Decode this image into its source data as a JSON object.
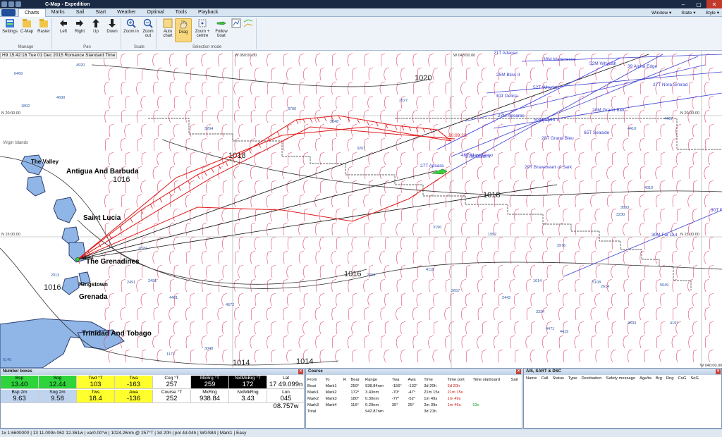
{
  "window": {
    "title": "C-Map - Expedition",
    "controls": [
      "–",
      "▢",
      "✕"
    ]
  },
  "menu": {
    "tabs": [
      "Charts",
      "Marks",
      "Sail",
      "Start",
      "Weather",
      "Optimal",
      "Tools",
      "Playback"
    ],
    "active_tab": "Charts",
    "right": [
      "Window ▾",
      "State ▾",
      "Style ▾"
    ]
  },
  "ribbon": {
    "groups": [
      {
        "label": "Manage",
        "buttons": [
          "Settings",
          "C-Map",
          "Raster"
        ]
      },
      {
        "label": "Pan",
        "buttons": [
          "Left",
          "Right",
          "Up",
          "Down"
        ]
      },
      {
        "label": "Scale",
        "buttons": [
          "Zoom in",
          "Zoom out"
        ]
      },
      {
        "label": "Selection mode",
        "buttons": [
          "Auto chart",
          "Drag",
          "Zoom + centre",
          "Follow boat"
        ]
      }
    ],
    "active_button": "Drag"
  },
  "chart": {
    "timestamp": "H9 15:42:16 Tue 01 Dec 2015 Romance Standard Time",
    "grid_labels": [
      "N 20:00.00",
      "N 15:00.00",
      "W 050:00.00",
      "W 045:00.00",
      "W 040:00.00",
      "N 20:00.00",
      "N 15:00.00"
    ],
    "places": [
      "Antigua And Barbuda",
      "Saint Lucia",
      "The Grenadines",
      "Grenada",
      "Trinidad And Tobago",
      "Kingstown",
      "The Valley",
      "Virgin Islands",
      "Mark4"
    ],
    "isobars": [
      "1020",
      "1018",
      "1018",
      "1016",
      "1016",
      "1016",
      "1014",
      "1014"
    ],
    "boats": [
      "27T Apsara",
      "27M Apsaras",
      "25M Bliss II",
      "30T Delica",
      "29T Braveheart of Sark",
      "28M Grand Bleu",
      "28T Grand Bleu",
      "65T Seaside",
      "30M Far Out",
      "30T Far Out",
      "39 Alpha Edge",
      "52M Whydah",
      "37M Gaint V",
      "63M Spirit V",
      "46T Marenesso",
      "27T Nora Simrad",
      "52T Whydah",
      "21T Adanac",
      "36M Marenesso"
    ],
    "own_boat_label": "20:09:23",
    "numbers": [
      "6469",
      "1802",
      "4690",
      "4920",
      "2491",
      "4401",
      "3264",
      "3700",
      "3548",
      "3267",
      "2527",
      "4410",
      "1952",
      "2976",
      "3693",
      "4407",
      "3230",
      "4010",
      "2442",
      "4672",
      "2303",
      "2657",
      "4119",
      "1614",
      "3324",
      "4471",
      "4419",
      "3196",
      "2614",
      "5108",
      "5049",
      "4693",
      "4197",
      "3048",
      "1171",
      "2870",
      "2913",
      "6140",
      "2491"
    ]
  },
  "number_boxes": {
    "title": "Number boxes",
    "row1": [
      {
        "label": "Bsp",
        "value": "13.40",
        "bg": "#2fd43c",
        "fg": "#000"
      },
      {
        "label": "Sog",
        "value": "12.44",
        "bg": "#2fd43c",
        "fg": "#000"
      },
      {
        "label": "Twd °T",
        "value": "103",
        "bg": "#ffff2e",
        "fg": "#000"
      },
      {
        "label": "Twa",
        "value": "-163",
        "bg": "#ffff2e",
        "fg": "#000"
      },
      {
        "label": "Cog °T",
        "value": "257",
        "bg": "#ffffff",
        "fg": "#000"
      },
      {
        "label": "MkBrg °T",
        "value": "259",
        "bg": "#000000",
        "fg": "#fff"
      },
      {
        "label": "NxtMkBrg °T",
        "value": "172",
        "bg": "#000000",
        "fg": "#fff"
      },
      {
        "label": "Lat",
        "value": "17 49.099n",
        "bg": "#ffffff",
        "fg": "#000"
      }
    ],
    "row2": [
      {
        "label": "Bsp 2m",
        "value": "9.63",
        "bg": "#bfd4ee",
        "fg": "#000"
      },
      {
        "label": "Sog 2m",
        "value": "9.58",
        "bg": "#bfd4ee",
        "fg": "#000"
      },
      {
        "label": "Tws",
        "value": "18.4",
        "bg": "#ffff2e",
        "fg": "#000"
      },
      {
        "label": "Awa",
        "value": "-136",
        "bg": "#ffff2e",
        "fg": "#000"
      },
      {
        "label": "Course °T",
        "value": "252",
        "bg": "#ffffff",
        "fg": "#000"
      },
      {
        "label": "MkRng",
        "value": "938.84",
        "bg": "#ffffff",
        "fg": "#000"
      },
      {
        "label": "NxtMkRng",
        "value": "3.43",
        "bg": "#ffffff",
        "fg": "#000"
      },
      {
        "label": "Lon",
        "value": "045 08.757w",
        "bg": "#ffffff",
        "fg": "#000"
      }
    ]
  },
  "course": {
    "title": "Course",
    "headers": [
      "From",
      "To",
      "R",
      "Bear",
      "Range",
      "Twa",
      "Awa",
      "Time",
      "Time port",
      "Time starboard",
      "Sail"
    ],
    "rows": [
      [
        "Boat",
        "Mark1",
        "",
        "259°",
        "938.84nm",
        "-156°",
        "-132°",
        "3d 20h",
        "3d 20h",
        "",
        ""
      ],
      [
        "Mark1",
        "Mark2",
        "",
        "172°",
        "3.43nm",
        "-70°",
        "-47°",
        "21m 15s",
        "21m 15s",
        "",
        ""
      ],
      [
        "Mark2",
        "Mark3",
        "",
        "180°",
        "0.30nm",
        "-77°",
        "-52°",
        "1m 49s",
        "1m 49s",
        "",
        ""
      ],
      [
        "Mark3",
        "Mark4",
        "",
        "116°",
        "0.29nm",
        "35°",
        "25°",
        "2m 39s",
        "1m 46s",
        "53s",
        ""
      ],
      [
        "Total",
        "",
        "",
        "",
        "942.87nm",
        "",
        "",
        "3d 21h",
        "",
        "",
        ""
      ]
    ]
  },
  "ais": {
    "title": "AIS, SART & DSC",
    "headers": [
      "Name",
      "Call",
      "Status",
      "Type",
      "Destination",
      "Safety message",
      "Age/ta",
      "Brg",
      "Rng",
      "CoG",
      "SoG"
    ]
  },
  "statusbar": "1x 1:6600000 | 13 11.009n 062 12.361w | var0.00°w | 1024.26nm @ 257°T | 3d 20h | pol 4d.04h | WGS84 | Mark1 | Easy"
}
